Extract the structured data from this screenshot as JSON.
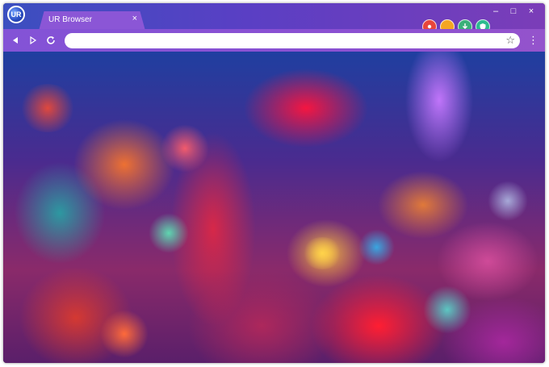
{
  "window": {
    "tab_title": "UR Browser",
    "tab_close": "×",
    "logo_text": "UR"
  },
  "controls": {
    "minimize": "–",
    "maximize": "□",
    "close": "×"
  },
  "extensions": [
    {
      "icon": "puzzle-icon",
      "color": "#e8463b"
    },
    {
      "icon": "circle-icon",
      "color": "#f5a623"
    },
    {
      "icon": "download-icon",
      "color": "#3bb07a"
    },
    {
      "icon": "shield-icon",
      "color": "#2dbb8f"
    }
  ],
  "toolbar": {
    "back_icon": "back-arrow-icon",
    "forward_icon": "forward-arrow-icon",
    "reload_icon": "reload-icon",
    "address_value": "",
    "address_placeholder": "",
    "bookmark_icon": "star-icon",
    "menu_icon": "vertical-dots-icon"
  },
  "content": {
    "description_type": "photo"
  },
  "colors": {
    "titlebar_start": "#3b4fc0",
    "titlebar_end": "#7b3db8",
    "toolbar": "#8353d6",
    "tab": "#8b56d6"
  }
}
